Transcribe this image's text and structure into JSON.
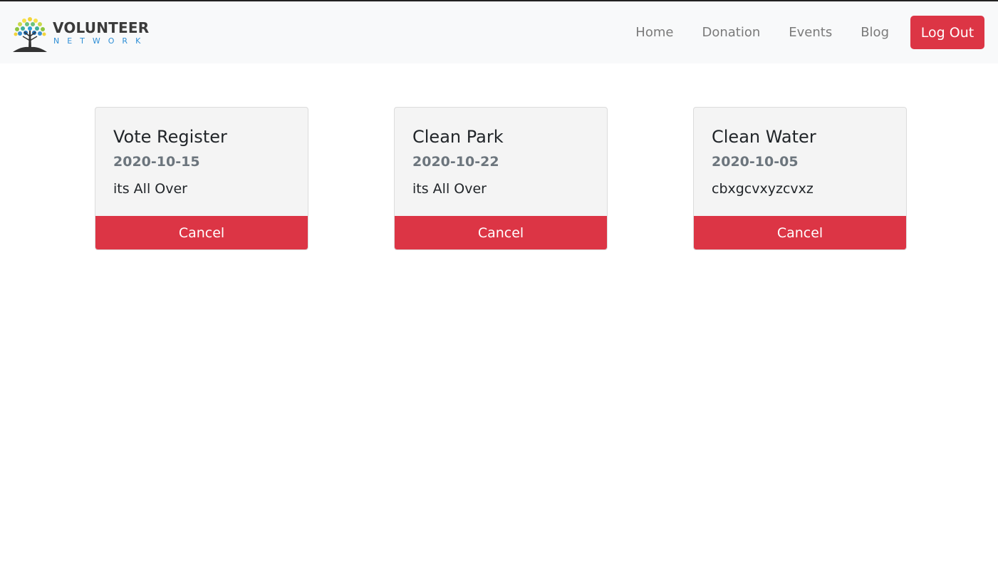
{
  "brand": {
    "name": "VOLUNTEER",
    "sub": "NETWORK",
    "icon": "tree-logo-icon"
  },
  "nav": {
    "items": [
      {
        "label": "Home"
      },
      {
        "label": "Donation"
      },
      {
        "label": "Events"
      },
      {
        "label": "Blog"
      }
    ],
    "logout_label": "Log Out"
  },
  "events": [
    {
      "title": "Vote Register",
      "date": "2020-10-15",
      "description": "its All Over",
      "cancel_label": "Cancel"
    },
    {
      "title": "Clean Park",
      "date": "2020-10-22",
      "description": "its All Over",
      "cancel_label": "Cancel"
    },
    {
      "title": "Clean Water",
      "date": "2020-10-05",
      "description": "cbxgcvxyzcvxz",
      "cancel_label": "Cancel"
    }
  ],
  "colors": {
    "accent": "#dc3545",
    "navbar_bg": "#f8f9fa",
    "card_bg": "#f4f4f4",
    "muted": "#6c757d",
    "brand_blue": "#2f8fd6"
  }
}
